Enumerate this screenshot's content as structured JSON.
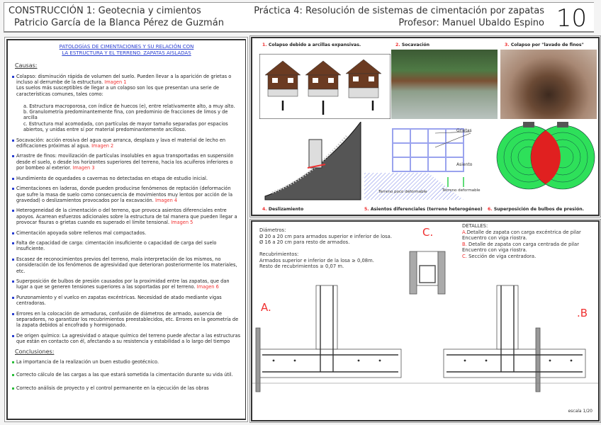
{
  "header": {
    "course": "CONSTRUCCIÓN 1: Geotecnia y cimientos",
    "author": "Patricio García de la Blanca Pérez de Guzmán",
    "practice": "Práctica 4: Resolución de sistemas de cimentación por zapatas",
    "professor": "Profesor: Manuel Ubaldo Espino",
    "number": "10"
  },
  "left": {
    "title1": "PATOLOGÍAS DE CIMENTACIONES Y SU RELACIÓN CON",
    "title2": "LA ESTRUCTURA Y EL TERRENO. ZAPATAS AISLADAS",
    "causes_heading": "Causas:",
    "c1": "Colapso: disminución rápida de volumen del suelo. Pueden llevar a la aparición de grietas o incluso al derrumbe de la estructura.",
    "c1_ref": "Imagen 1",
    "c1_more": "Los suelos más susceptibles de llegar a un colapso son los que presentan una serie de características comunes, tales como:",
    "c1_a": "a. Estructura macroporosa, con índice de huecos (e), entre relativamente alto, a muy alto.",
    "c1_b": "b. Granulometría predominantemente fina, con predominio de fracciones de limos y de arcilla",
    "c1_c": "c. Estructura mal acomodada, con partículas de mayor tamaño separadas por espacios abiertos, y unidas entre sí por material predominantemente arcilloso.",
    "c2": "Socavación: acción erosiva del agua que arranca, desplaza y lava el material de lecho en edificaciones próximas al agua.",
    "c2_ref": "Imagen 2",
    "c3": "Arrastre de finos: movilización de partículas insolubles en agua transportadas en suspensión desde el suelo, o desde los horizontes superiores del terreno, hacia los acuíferos inferiores o por bombeo al exterior.",
    "c3_ref": "Imagen 3",
    "c4": "Hundimiento de oquedades o cavernas no detectadas en etapa de estudio inicial.",
    "c5": "Cimentaciones en laderas, donde pueden producirse fenómenos de reptación (deformación que sufre la masa de suelo como consecuencia de movimientos muy lentos por acción de la gravedad) o deslizamientos provocados por la excavación.",
    "c5_ref": "Imagen 4",
    "c6": "Heterogeneidad de la cimentación o del terreno, que provoca asientos diferenciales entre apoyos. Acarrean esfuerzos adicionales sobre la estructura de tal manera que pueden llegar a provocar fisuras o grietas cuando es superado el límite tensional.",
    "c6_ref": "Imagen 5",
    "c7": "Cimentación apoyada sobre rellenos mal compactados.",
    "c8": "Falta de capacidad de carga: cimentación insuficiente o capacidad de carga del suelo insuficiente.",
    "c9": "Escasez de reconocimientos previos del terreno, mala interpretación de los mismos, no consideración de los fenómenos de agresividad que deterioran posteriormente los materiales, etc.",
    "c10": "Superposición de bulbos de presión causados por la proximidad entre las zapatas, que dan lugar a que se generen tensiones superiores a las soportadas por el terreno.",
    "c10_ref": "Imagen 6",
    "c11": "Punzonamiento y el vuelco en zapatas excéntricas. Necesidad de atado mediante vigas centradoras.",
    "c12": "Errores en la colocación de armaduras, confusión de diámetros de armado, ausencia de separadores, no garantizar los recubrimientos preestablecidos, etc. Errores en la geometría de la zapata debidos al encofrado y hormigonado.",
    "c13": "De origen químico: La agresividad o ataque químico del terreno puede afectar a las estructuras que están en contacto con él, afectando a su resistencia y estabilidad a lo largo del tiempo",
    "concl_heading": "Conclusiones:",
    "k1": "La importancia de la realización un buen estudio geotécnico.",
    "k2": "Correcto cálculo de las cargas a las que estará sometida la cimentación durante su vida útil.",
    "k3": "Correcto análisis de proyecto y el control permanente en la ejecución de las obras"
  },
  "figures": [
    {
      "n": "1.",
      "label": "Colapso debido a arcillas expansivas."
    },
    {
      "n": "2.",
      "label": "Socavación"
    },
    {
      "n": "3.",
      "label": "Colapso por \"lavado de finos\""
    },
    {
      "n": "4.",
      "label": "Deslizamiento"
    },
    {
      "n": "5.",
      "label": "Asientos diferenciales (terreno heterogéneo)"
    },
    {
      "n": "6.",
      "label": "Superposición de bulbos de presión."
    }
  ],
  "fig5": {
    "cracks": "Grietas",
    "settlement": "Asiento",
    "firm": "Terreno poco deformable",
    "soft": "Terreno deformable"
  },
  "details": {
    "diam_h": "Diámetros:",
    "diam1": "Ø 20 a 20 cm para armados superior e inferior de losa.",
    "diam2": "Ø 16 a 20 cm para resto de armados.",
    "rec_h": "Recubrimientos:",
    "rec1": "Armados superior e inferior de la losa ≥ 0,08m.",
    "rec2": "Resto de recubrimientos ≥ 0,07 m.",
    "det_h": "DETALLES:",
    "a": "A.",
    "a_t": "Detalle de zapata con carga excéntrica de pilar",
    "a_t2": "Encuentro con viga riostra.",
    "b": "B.",
    "b_t": "Detalle de zapata con carga centrada de pilar",
    "b_t2": "Encuentro con viga riostra.",
    "c": "C.",
    "c_t": "Sección de viga centradora.",
    "big_a": "A.",
    "big_b": ".B",
    "big_c": "C.",
    "scale": "escala 1/20"
  },
  "colors": {
    "accent": "#f03030",
    "link": "#2a3fd0",
    "bulb": "#2ee05a"
  }
}
